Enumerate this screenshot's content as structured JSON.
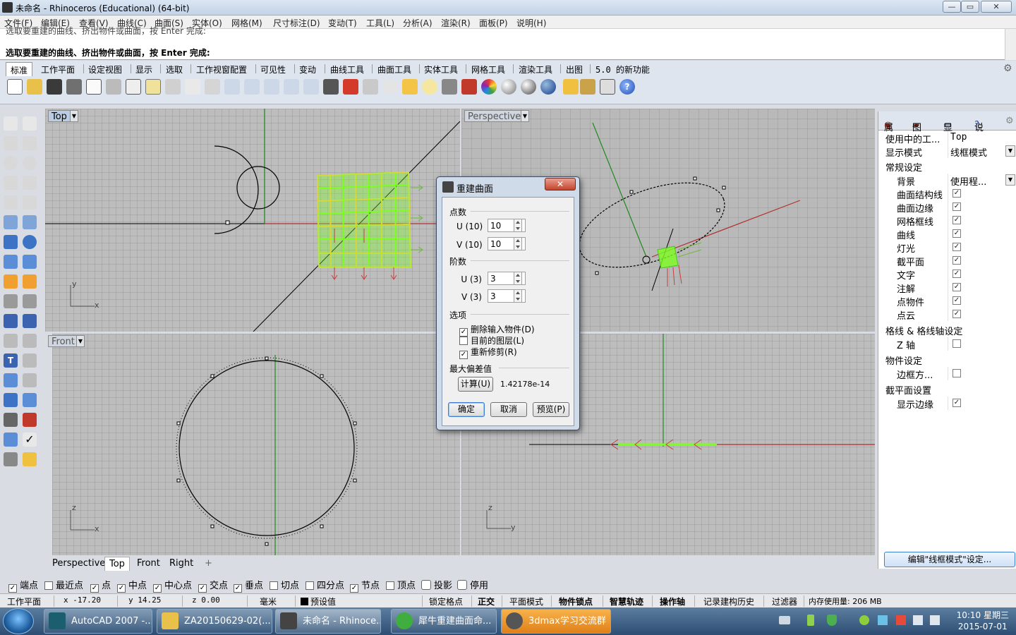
{
  "window": {
    "title": "未命名 - Rhinoceros (Educational) (64-bit)",
    "minimize": "—",
    "maximize": "▭",
    "close": "✕"
  },
  "menu": [
    "文件(F)",
    "编辑(E)",
    "查看(V)",
    "曲线(C)",
    "曲面(S)",
    "实体(O)",
    "网格(M)",
    "尺寸标注(D)",
    "变动(T)",
    "工具(L)",
    "分析(A)",
    "渲染(R)",
    "面板(P)",
    "说明(H)"
  ],
  "command": {
    "history": "选取要重建的曲线、挤出物件或曲面，按 Enter 完成:",
    "prompt": "选取要重建的曲线、挤出物件或曲面，按 Enter 完成:"
  },
  "toolbar_tabs": [
    "标准",
    "工作平面",
    "设定视图",
    "显示",
    "选取",
    "工作视窗配置",
    "可见性",
    "变动",
    "曲线工具",
    "曲面工具",
    "实体工具",
    "网格工具",
    "渲染工具",
    "出图",
    "5.0 的新功能"
  ],
  "viewports": {
    "top": {
      "label": "Top",
      "axis_y": "y",
      "axis_x": "x"
    },
    "perspective": {
      "label": "Perspective"
    },
    "front": {
      "label": "Front",
      "axis_y": "z",
      "axis_x": "x"
    },
    "right": {
      "axis_y": "z",
      "axis_x": "y"
    }
  },
  "viewport_tabs": [
    "Perspective",
    "Top",
    "Front",
    "Right"
  ],
  "viewport_tab_add": "+",
  "right_panel": {
    "tabs": [
      "属",
      "图",
      "显",
      "说"
    ],
    "rows": [
      {
        "key": "使用中的工...",
        "value": "Top"
      },
      {
        "key": "显示模式",
        "value": "线框模式"
      }
    ],
    "section_general": "常规设定",
    "background": {
      "key": "背景",
      "value": "使用程..."
    },
    "checks": [
      {
        "label": "曲面结构线",
        "checked": true
      },
      {
        "label": "曲面边缘",
        "checked": true
      },
      {
        "label": "网格框线",
        "checked": true
      },
      {
        "label": "曲线",
        "checked": true
      },
      {
        "label": "灯光",
        "checked": true
      },
      {
        "label": "截平面",
        "checked": true
      },
      {
        "label": "文字",
        "checked": true
      },
      {
        "label": "注解",
        "checked": true
      },
      {
        "label": "点物件",
        "checked": true
      },
      {
        "label": "点云",
        "checked": true
      }
    ],
    "section_grid": "格线 & 格线轴设定",
    "grid_z": {
      "label": "Z 轴",
      "checked": false
    },
    "section_object": "物件设定",
    "bbox": {
      "label": "边框方...",
      "checked": false
    },
    "section_clip": "截平面设置",
    "show_edges": {
      "label": "显示边缘",
      "checked": true
    },
    "edit_button": "编辑\"线框模式\"设定..."
  },
  "dialog": {
    "title": "重建曲面",
    "group_points": "点数",
    "u_points_label": "U (10)",
    "u_points": "10",
    "v_points_label": "V (10)",
    "v_points": "10",
    "group_degree": "阶数",
    "u_degree_label": "U (3)",
    "u_degree": "3",
    "v_degree_label": "V (3)",
    "v_degree": "3",
    "group_options": "选项",
    "opt_delete": {
      "label": "删除输入物件(D)",
      "checked": true
    },
    "opt_layer": {
      "label": "目前的图层(L)",
      "checked": false
    },
    "opt_trim": {
      "label": "重新修剪(R)",
      "checked": true
    },
    "group_deviation": "最大偏差值",
    "calc_button": "计算(U)",
    "deviation": "1.42178e-14",
    "ok": "确定",
    "cancel": "取消",
    "preview": "预览(P)"
  },
  "osnaps": [
    {
      "label": "端点",
      "checked": true
    },
    {
      "label": "最近点",
      "checked": false
    },
    {
      "label": "点",
      "checked": true
    },
    {
      "label": "中点",
      "checked": true
    },
    {
      "label": "中心点",
      "checked": true
    },
    {
      "label": "交点",
      "checked": true
    },
    {
      "label": "垂点",
      "checked": true
    },
    {
      "label": "切点",
      "checked": false
    },
    {
      "label": "四分点",
      "checked": false
    },
    {
      "label": "节点",
      "checked": true
    },
    {
      "label": "顶点",
      "checked": false
    },
    {
      "label": "投影",
      "checked": false
    },
    {
      "label": "停用",
      "checked": false
    }
  ],
  "status": {
    "cplane": "工作平面",
    "x": "x -17.20",
    "y": "y 14.25",
    "z": "z 0.00",
    "units": "毫米",
    "layer": "预设值",
    "toggles": [
      "锁定格点",
      "正交",
      "平面模式",
      "物件锁点",
      "智慧轨迹",
      "操作轴",
      "记录建构历史",
      "过滤器"
    ],
    "memory": "内存使用量: 206 MB"
  },
  "taskbar": {
    "items": [
      "AutoCAD 2007 -...",
      "ZA20150629-02(...",
      "未命名 - Rhinoce...",
      "犀牛重建曲面命...",
      "3dmax学习交流群"
    ],
    "time": "10:10 星期三",
    "date": "2015-07-01"
  },
  "colors": {
    "accent": "#3b7fd5",
    "xaxis": "#b03030",
    "yaxis": "#1f8a1f",
    "surface": "#7cff1e",
    "viewport_bg": "#bdbdbd"
  }
}
